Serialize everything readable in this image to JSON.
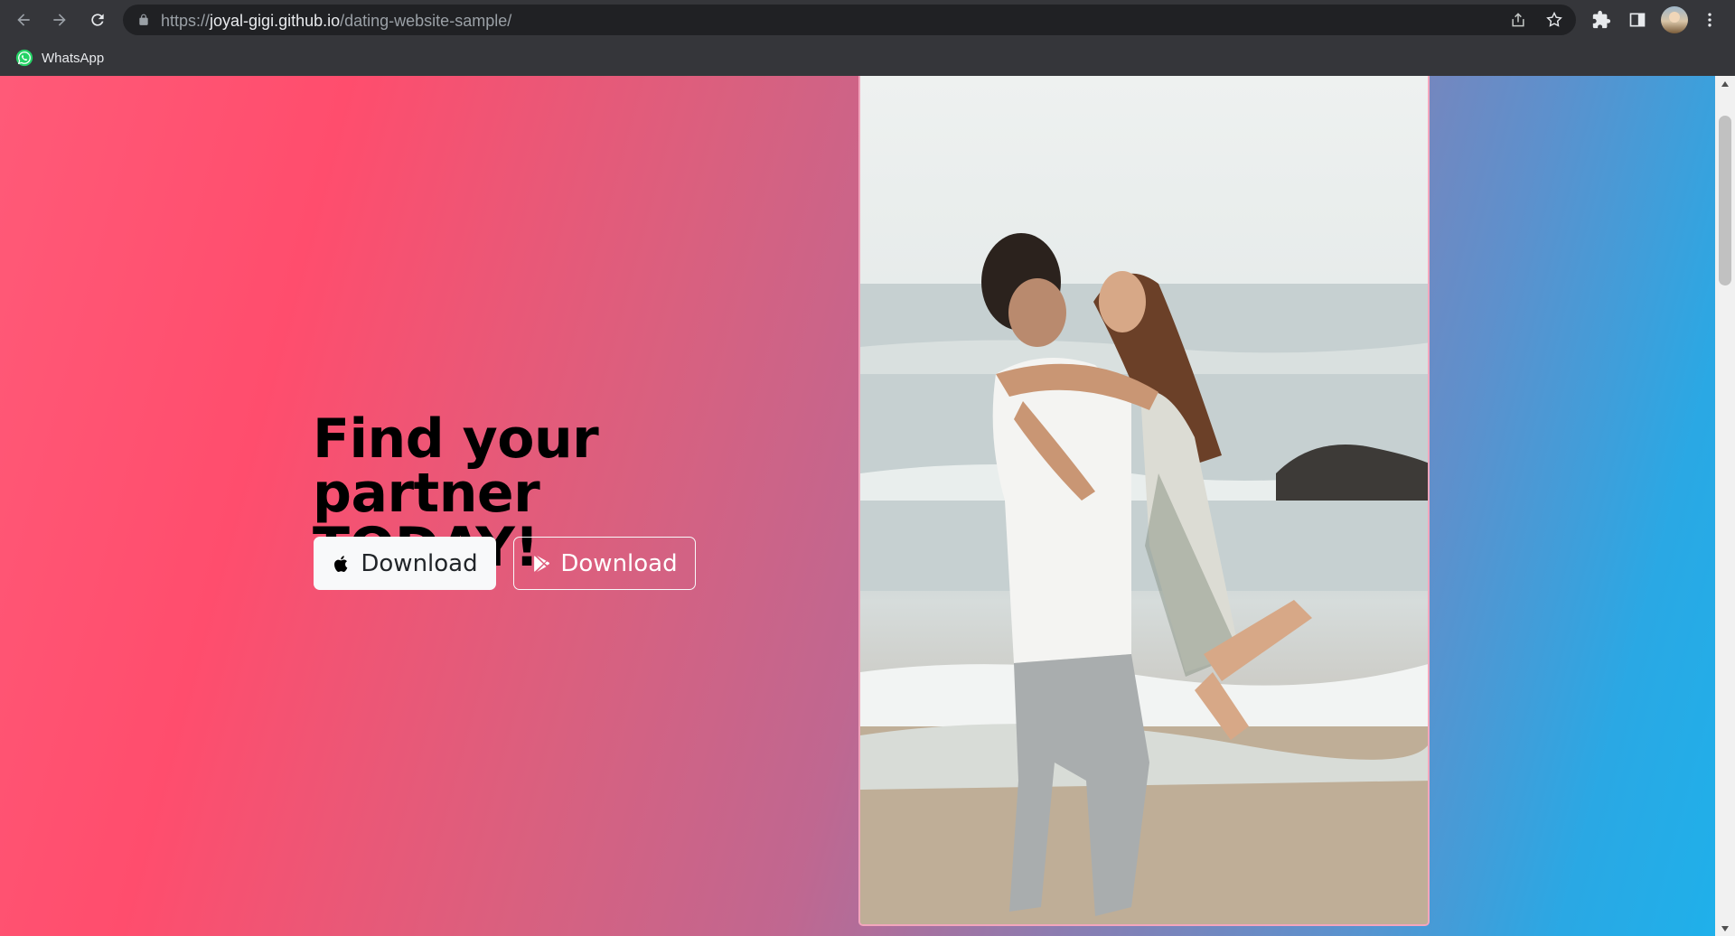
{
  "browser": {
    "url_scheme": "https://",
    "url_host": "joyal-gigi.github.io",
    "url_path": "/dating-website-sample/"
  },
  "bookmarks": [
    {
      "label": "WhatsApp",
      "icon": "whatsapp-icon"
    }
  ],
  "hero": {
    "headline_line1": "Find your partner",
    "headline_line2": "TODAY!",
    "buttons": [
      {
        "label": "Download",
        "icon": "apple-icon",
        "style": "light"
      },
      {
        "label": "Download",
        "icon": "google-play-icon",
        "style": "outline"
      }
    ],
    "image_description_alt": ""
  },
  "colors": {
    "gradient_start": "#ff4d6d",
    "gradient_end": "#1fb0ea",
    "button_light": "#f8f9fa",
    "photo_border": "#f3a6bd"
  }
}
